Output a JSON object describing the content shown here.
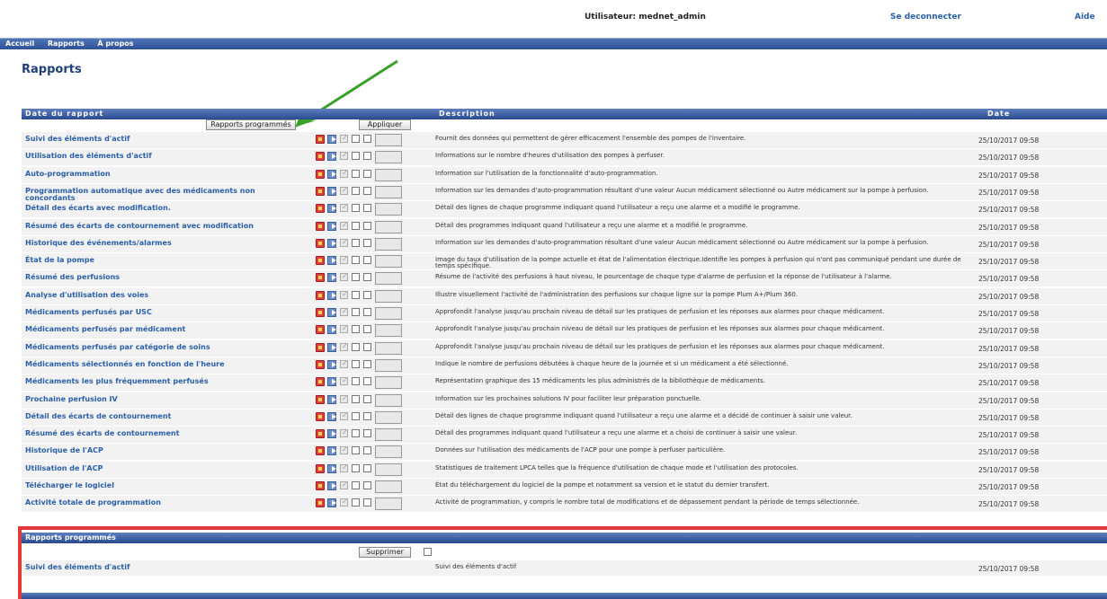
{
  "topbar": {
    "user": "Utilisateur: mednet_admin",
    "logout": "Se deconnecter",
    "help": "Aide"
  },
  "nav": [
    "Accueil",
    "Rapports",
    "À propos"
  ],
  "page_title": "Rapports",
  "table": {
    "col_date": "Date du rapport",
    "col_desc": "Description",
    "col_time": "Date",
    "scheduled_button": "Rapports programmés",
    "apply_button": "Appliquer",
    "rows": [
      {
        "name": "Suivi des éléments d'actif",
        "desc": "Fournit des données qui permettent de gérer efficacement l'ensemble des pompes de l'inventaire.",
        "date": "25/10/2017 09:58"
      },
      {
        "name": "Utilisation des éléments d'actif",
        "desc": "Informations sur le nombre d'heures d'utilisation des pompes à perfuser.",
        "date": "25/10/2017 09:58"
      },
      {
        "name": "Auto-programmation",
        "desc": "Information sur l'utilisation de la fonctionnalité d'auto-programmation.",
        "date": "25/10/2017 09:58"
      },
      {
        "name": "Programmation automatique avec des médicaments non concordants",
        "desc": "Information sur les demandes d'auto-programmation résultant d'une valeur Aucun médicament sélectionné ou Autre médicament sur la pompe à perfusion.",
        "date": "25/10/2017 09:58"
      },
      {
        "name": "Détail des écarts avec modification.",
        "desc": "Détail des lignes de chaque programme indiquant quand l'utilisateur a reçu une alarme et a modifié le programme.",
        "date": "25/10/2017 09:58"
      },
      {
        "name": "Résumé des écarts de contournement avec modification",
        "desc": "Détail des programmes indiquant quand l'utilisateur a reçu une alarme et a modifié le programme.",
        "date": "25/10/2017 09:58"
      },
      {
        "name": "Historique des événements/alarmes",
        "desc": "Information sur les demandes d'auto-programmation résultant d'une valeur Aucun médicament sélectionné ou Autre médicament sur la pompe à perfusion.",
        "date": "25/10/2017 09:58"
      },
      {
        "name": "État de la pompe",
        "desc": "Image du taux d'utilisation de la pompe actuelle et état de l'alimentation électrique.Identifie les pompes à perfusion qui n'ont pas communiqué pendant une durée de temps spécifique.",
        "date": "25/10/2017 09:58"
      },
      {
        "name": "Résumé des perfusions",
        "desc": "Résume de l'activité des perfusions à haut niveau, le pourcentage de chaque type d'alarme de perfusion et la réponse de l'utilisateur à l'alarme.",
        "date": "25/10/2017 09:58"
      },
      {
        "name": "Analyse d'utilisation des voies",
        "desc": "Illustre visuellement l'activité de l'administration des perfusions sur chaque ligne sur la pompe Plum A+/Plum 360.",
        "date": "25/10/2017 09:58"
      },
      {
        "name": "Médicaments perfusés par USC",
        "desc": "Approfondit l'analyse jusqu'au prochain niveau de détail sur les pratiques de perfusion et les réponses aux alarmes pour chaque médicament.",
        "date": "25/10/2017 09:58"
      },
      {
        "name": "Médicaments perfusés par médicament",
        "desc": "Approfondit l'analyse jusqu'au prochain niveau de détail sur les pratiques de perfusion et les réponses aux alarmes pour chaque médicament.",
        "date": "25/10/2017 09:58"
      },
      {
        "name": "Médicaments perfusés par catégorie de soins",
        "desc": "Approfondit l'analyse jusqu'au prochain niveau de détail sur les pratiques de perfusion et les réponses aux alarmes pour chaque médicament.",
        "date": "25/10/2017 09:58"
      },
      {
        "name": "Médicaments sélectionnés en fonction de l'heure",
        "desc": "Indique le nombre de perfusions débutées à chaque heure de la journée et si un médicament a été sélectionné.",
        "date": "25/10/2017 09:58"
      },
      {
        "name": "Médicaments les plus fréquemment perfusés",
        "desc": "Représentation graphique des 15 médicaments les plus administrés de la bibliothèque de médicaments.",
        "date": "25/10/2017 09:58"
      },
      {
        "name": "Prochaine perfusion IV",
        "desc": "Information sur les prochaines solutions IV pour faciliter leur préparation ponctuelle.",
        "date": "25/10/2017 09:58"
      },
      {
        "name": "Détail des écarts de contournement",
        "desc": "Détail des lignes de chaque programme indiquant quand l'utilisateur a reçu une alarme et a décidé de continuer à saisir une valeur.",
        "date": "25/10/2017 09:58"
      },
      {
        "name": "Résumé des écarts de contournement",
        "desc": "Détail des programmes indiquant quand l'utilisateur a reçu une alarme et a choisi de continuer à saisir une valeur.",
        "date": "25/10/2017 09:58"
      },
      {
        "name": "Historique de l'ACP",
        "desc": "Données sur l'utilisation des médicaments de l'ACP pour une pompe à perfuser particulière.",
        "date": "25/10/2017 09:58"
      },
      {
        "name": "Utilisation de l'ACP",
        "desc": "Statistiques de traitement LPCA telles que la fréquence d'utilisation de chaque mode et l'utilisation des protocoles.",
        "date": "25/10/2017 09:58"
      },
      {
        "name": "Télécharger le logiciel",
        "desc": "État du téléchargement du logiciel de la pompe et notamment sa version et le statut du dernier transfert.",
        "date": "25/10/2017 09:58"
      },
      {
        "name": "Activité totale de programmation",
        "desc": "Activité de programmation, y compris le nombre total de modifications et de dépassement pendant la période de temps sélectionnée.",
        "date": "25/10/2017 09:58"
      }
    ]
  },
  "scheduled": {
    "title": "Rapports programmés",
    "delete_button": "Supprimer",
    "row": {
      "name": "Suivi des éléments d'actif",
      "desc": "Suivi des éléments d'actif",
      "date": "25/10/2017 09:58"
    }
  }
}
